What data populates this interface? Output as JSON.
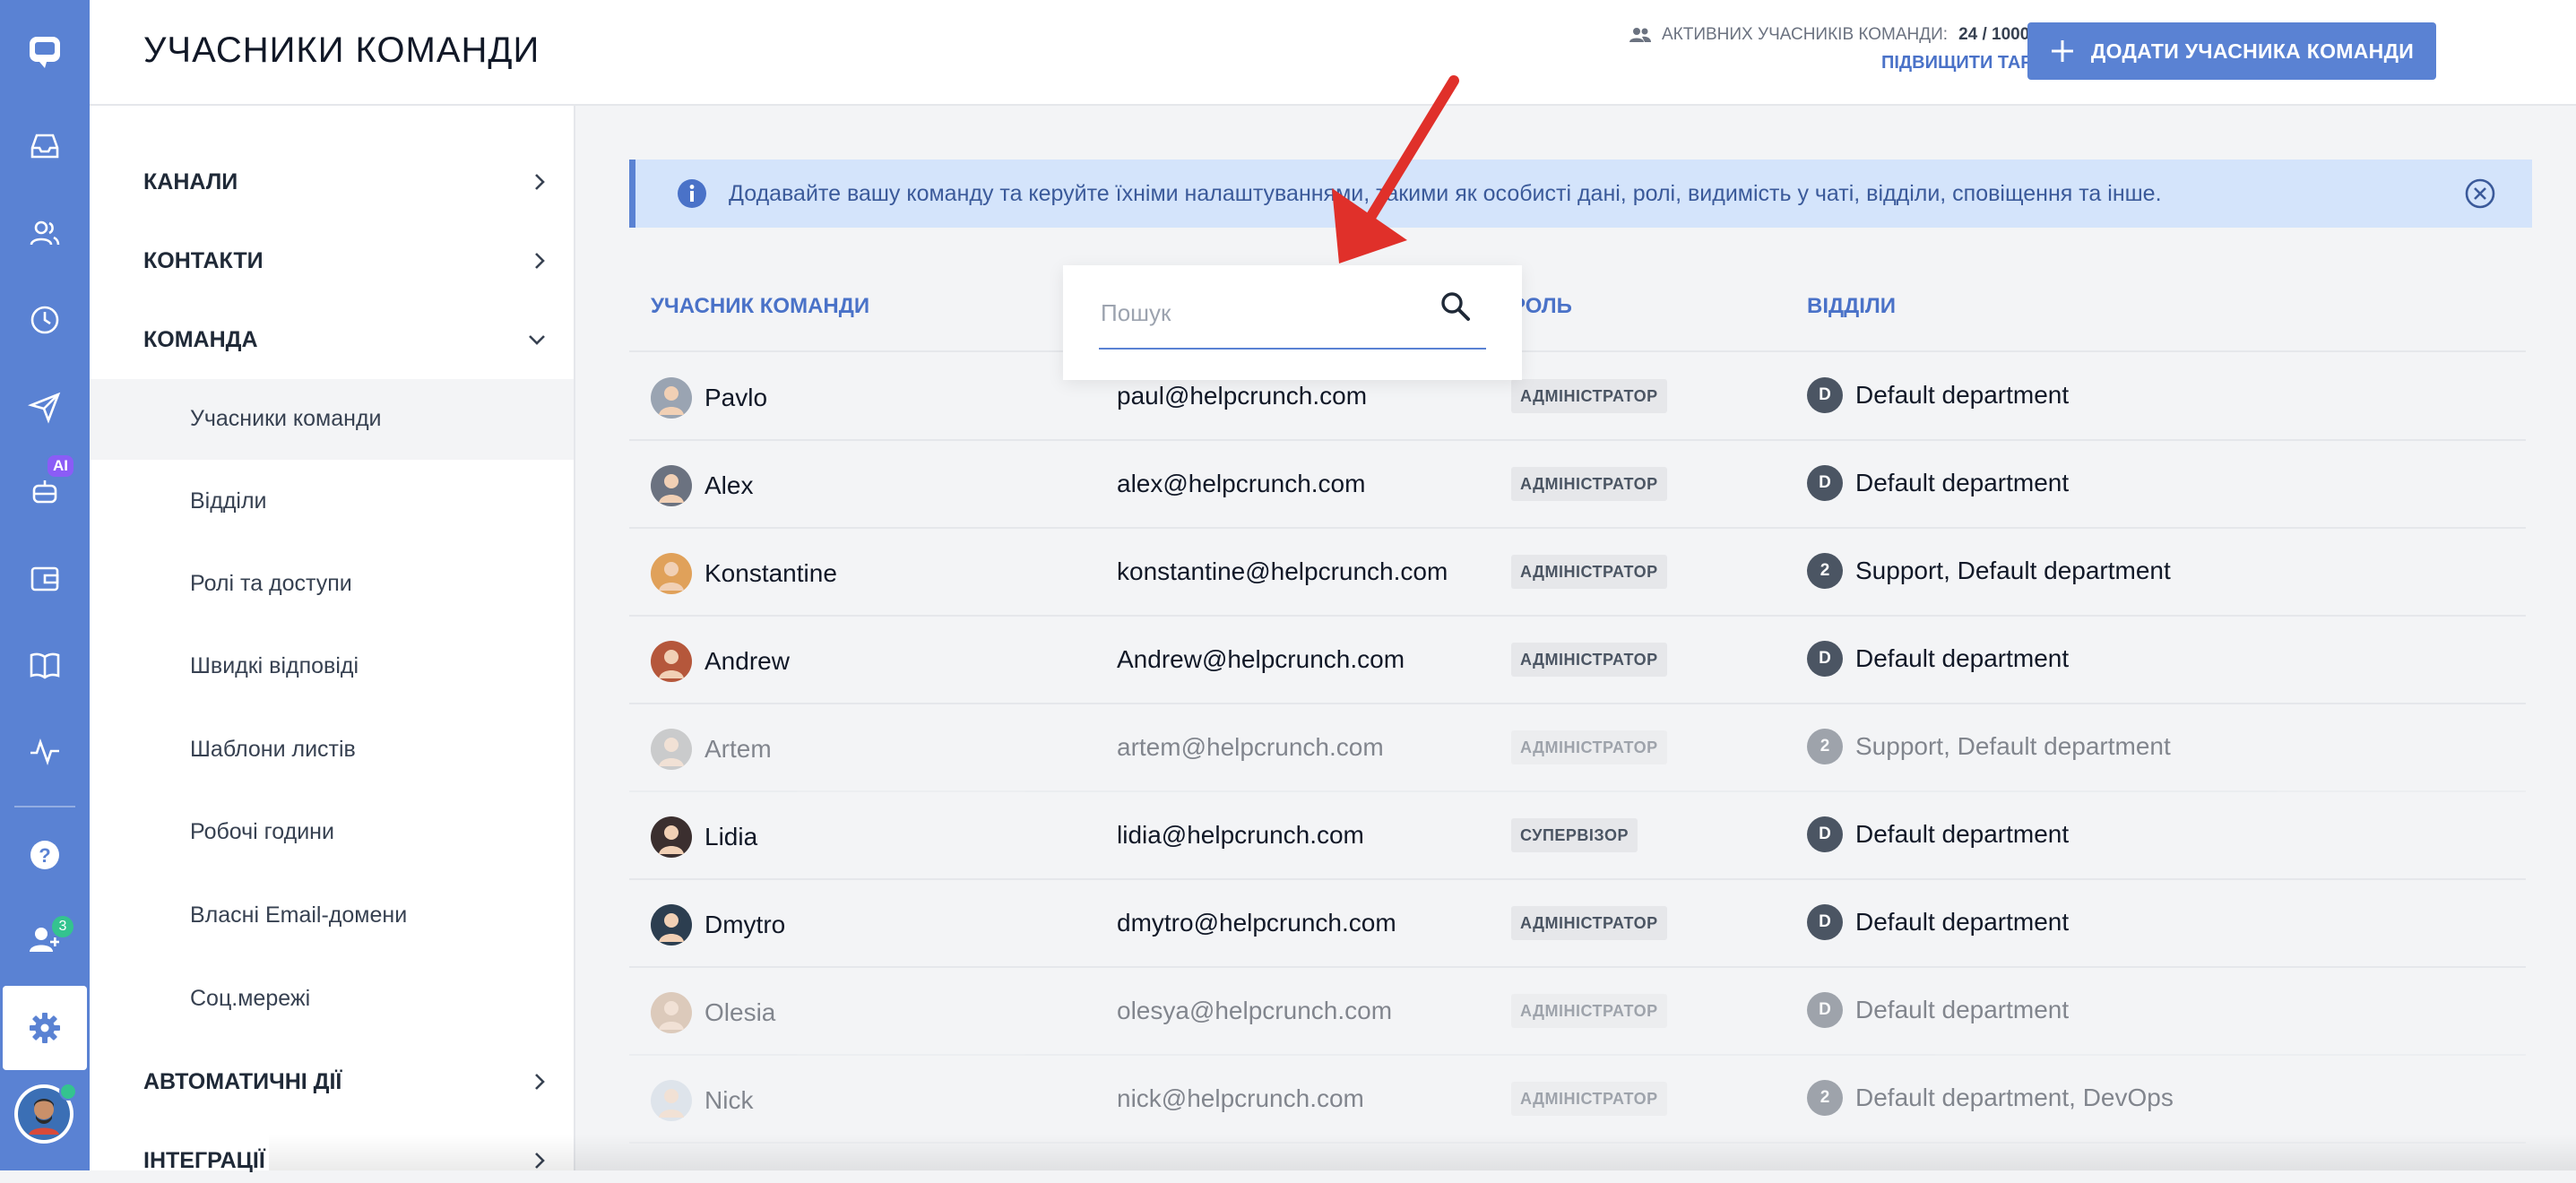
{
  "header": {
    "title": "УЧАСНИКИ КОМАНДИ",
    "active_label": "АКТИВНИХ УЧАСНИКІВ КОМАНДИ:",
    "active_count": "24 / 1000",
    "upgrade_label": "ПІДВИЩИТИ ТАРИФ",
    "add_button_label": "ДОДАТИ УЧАСНИКА КОМАНДИ"
  },
  "rail": {
    "ai_badge": "AI",
    "team_badge": "3",
    "icons": [
      "chat-logo-icon",
      "inbox-icon",
      "contacts-icon",
      "history-icon",
      "send-icon",
      "ai-bot-icon",
      "wallet-icon",
      "knowledge-base-icon",
      "activity-icon",
      "help-icon",
      "team-icon",
      "settings-icon"
    ]
  },
  "sidebar": {
    "sections": [
      {
        "label": "КАНАЛИ"
      },
      {
        "label": "КОНТАКТИ"
      },
      {
        "label": "КОМАНДА"
      },
      {
        "label": "АВТОМАТИЧНІ ДІЇ"
      },
      {
        "label": "ІНТЕГРАЦІЇ"
      }
    ],
    "items": [
      {
        "label": "Учасники команди"
      },
      {
        "label": "Відділи"
      },
      {
        "label": "Ролі та доступи"
      },
      {
        "label": "Швидкі відповіді"
      },
      {
        "label": "Шаблони листів"
      },
      {
        "label": "Робочі години"
      },
      {
        "label": "Власні Email-домени"
      },
      {
        "label": "Соц.мережі"
      }
    ]
  },
  "banner": {
    "text": "Додавайте вашу команду та керуйте їхніми налаштуваннями, такими як особисті дані, ролі, видимість у чаті, відділи, сповіщення та інше."
  },
  "search": {
    "placeholder": "Пошук"
  },
  "table": {
    "columns": {
      "member": "УЧАСНИК КОМАНДИ",
      "role": "РОЛЬ",
      "departments": "ВІДДІЛИ"
    },
    "rows": [
      {
        "name": "Pavlo",
        "email": "paul@helpcrunch.com",
        "role": "АДМІНІСТРАТОР",
        "dept_badge": "D",
        "departments": "Default department",
        "inactive": false
      },
      {
        "name": "Alex",
        "email": "alex@helpcrunch.com",
        "role": "АДМІНІСТРАТОР",
        "dept_badge": "D",
        "departments": "Default department",
        "inactive": false
      },
      {
        "name": "Konstantine",
        "email": "konstantine@helpcrunch.com",
        "role": "АДМІНІСТРАТОР",
        "dept_badge": "2",
        "departments": "Support, Default department",
        "inactive": false
      },
      {
        "name": "Andrew",
        "email": "Andrew@helpcrunch.com",
        "role": "АДМІНІСТРАТОР",
        "dept_badge": "D",
        "departments": "Default department",
        "inactive": false
      },
      {
        "name": "Artem",
        "email": "artem@helpcrunch.com",
        "role": "АДМІНІСТРАТОР",
        "dept_badge": "2",
        "departments": "Support, Default department",
        "inactive": true
      },
      {
        "name": "Lidia",
        "email": "lidia@helpcrunch.com",
        "role": "СУПЕРВІЗОР",
        "dept_badge": "D",
        "departments": "Default department",
        "inactive": false
      },
      {
        "name": "Dmytro",
        "email": "dmytro@helpcrunch.com",
        "role": "АДМІНІСТРАТОР",
        "dept_badge": "D",
        "departments": "Default department",
        "inactive": false
      },
      {
        "name": "Olesia",
        "email": "olesya@helpcrunch.com",
        "role": "АДМІНІСТРАТОР",
        "dept_badge": "D",
        "departments": "Default department",
        "inactive": true
      },
      {
        "name": "Nick",
        "email": "nick@helpcrunch.com",
        "role": "АДМІНІСТРАТОР",
        "dept_badge": "2",
        "departments": "Default department, DevOps",
        "inactive": true
      }
    ]
  },
  "colors": {
    "accent": "#5a82d3",
    "link": "#4a72c8",
    "banner_bg": "#d4e4fb",
    "annotation_arrow": "#e0302a",
    "online": "#34c38f"
  }
}
